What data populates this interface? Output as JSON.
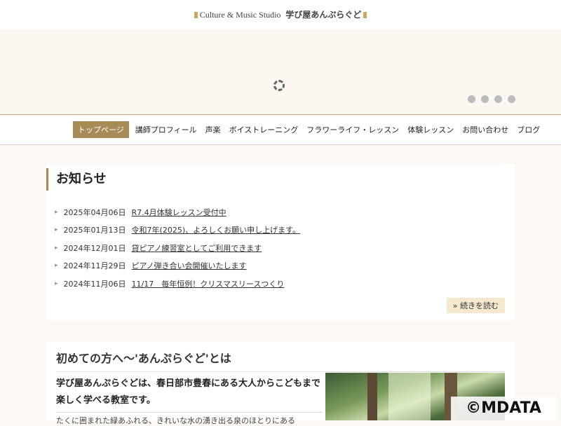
{
  "header": {
    "logo_en": "Culture & Music Studio",
    "logo_jp": "学び屋あんぷらぐど"
  },
  "slider": {
    "dot_count": 4
  },
  "nav": {
    "items": [
      {
        "label": "トップページ",
        "active": true
      },
      {
        "label": "講師プロフィール"
      },
      {
        "label": "声楽"
      },
      {
        "label": "ボイストレーニング"
      },
      {
        "label": "フラワーライフ・レッスン"
      },
      {
        "label": "体験レッスン"
      },
      {
        "label": "お問い合わせ"
      },
      {
        "label": "ブログ"
      }
    ]
  },
  "news": {
    "title": "お知らせ",
    "items": [
      {
        "date": "2025年04月06日",
        "text": "R7.4月体験レッスン受付中"
      },
      {
        "date": "2025年01月13日",
        "text": "令和7年(2025)、よろしくお願い申し上げます。"
      },
      {
        "date": "2024年12月01日",
        "text": "貸ピアノ練習室としてご利用できます"
      },
      {
        "date": "2024年11月29日",
        "text": "ピアノ弾き合い会開催いたします"
      },
      {
        "date": "2024年11月06日",
        "text": "11/17　毎年恒例！クリスマスリースつくり"
      }
    ],
    "more_label": "» 続きを読む"
  },
  "intro": {
    "title": "初めての方へ～'あんぷらぐど'とは",
    "lead": "学び屋あんぷらぐどは、春日部市豊春にある大人からこどもまで楽しく学べる教室です。",
    "sub": "たくに囲まれた緑あふれる、きれいな水の湧き出る泉のほとりにある"
  },
  "watermark": "©MDATA",
  "colors": {
    "accent": "#a78b57",
    "background": "#fdf8f3",
    "more_button_bg": "#f6e7cf"
  }
}
